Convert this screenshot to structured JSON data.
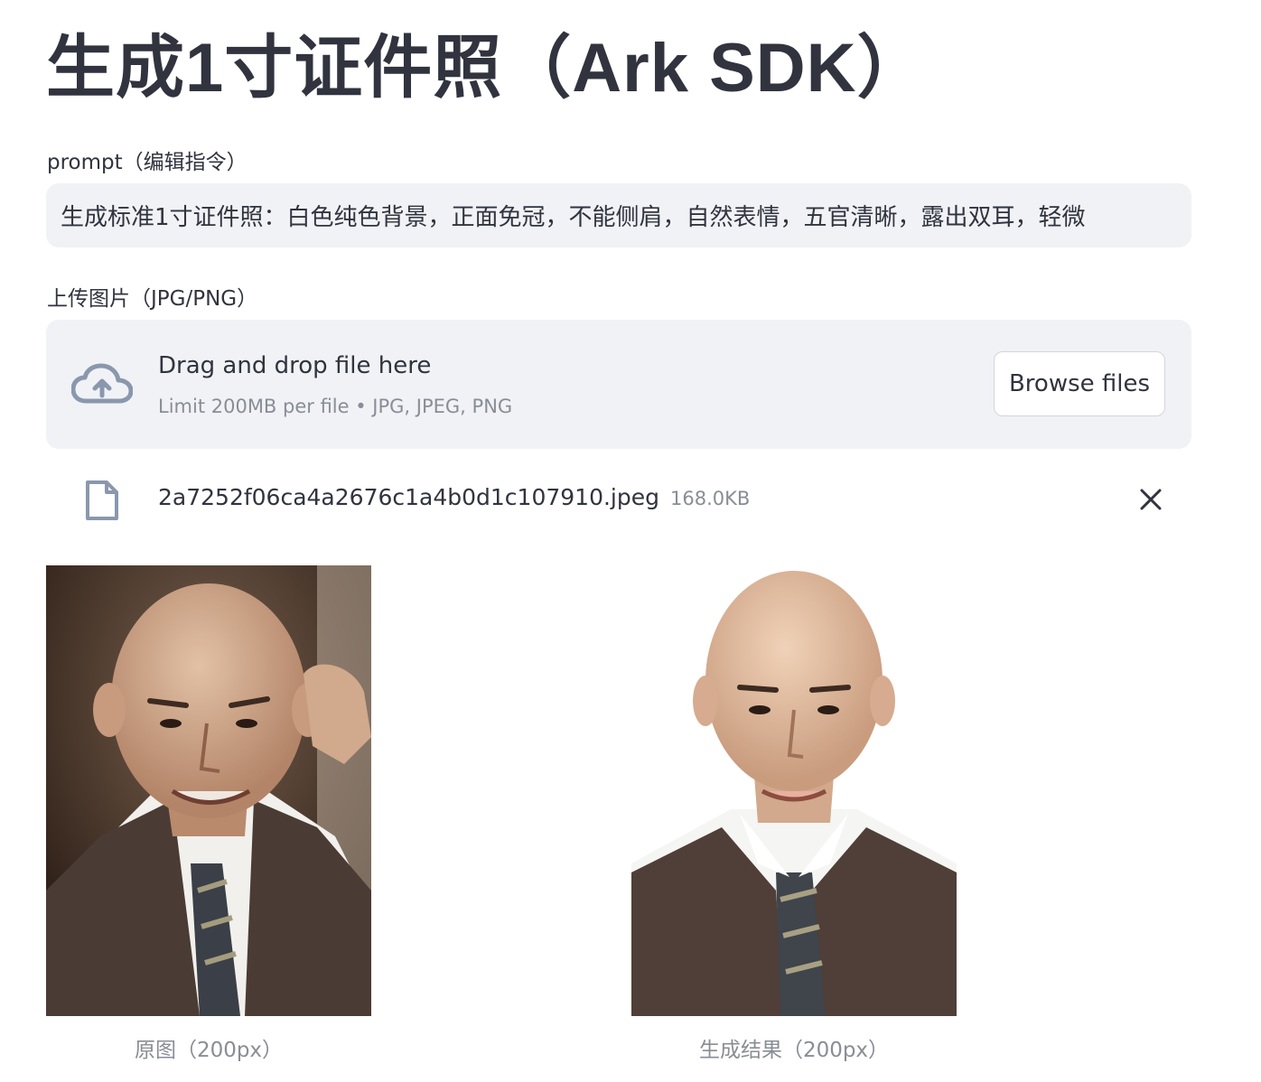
{
  "title": "生成1寸证件照（Ark SDK）",
  "prompt": {
    "label": "prompt（编辑指令）",
    "value": "生成标准1寸证件照：白色纯色背景，正面免冠，不能侧肩，自然表情，五官清晰，露出双耳，轻微"
  },
  "upload": {
    "label": "上传图片（JPG/PNG）",
    "drop_title": "Drag and drop file here",
    "drop_subtitle": "Limit 200MB per file • JPG, JPEG, PNG",
    "browse_label": "Browse files",
    "cloud_icon": "cloud-upload-icon"
  },
  "file": {
    "name": "2a7252f06ca4a2676c1a4b0d1c107910.jpeg",
    "size": "168.0KB",
    "icon": "file-icon",
    "remove_icon": "close-icon"
  },
  "images": {
    "original_caption": "原图（200px）",
    "result_caption": "生成结果（200px）"
  },
  "colors": {
    "text": "#31333f",
    "muted": "#8a8d95",
    "panel": "#f0f2f6",
    "icon": "#8a97ad"
  }
}
